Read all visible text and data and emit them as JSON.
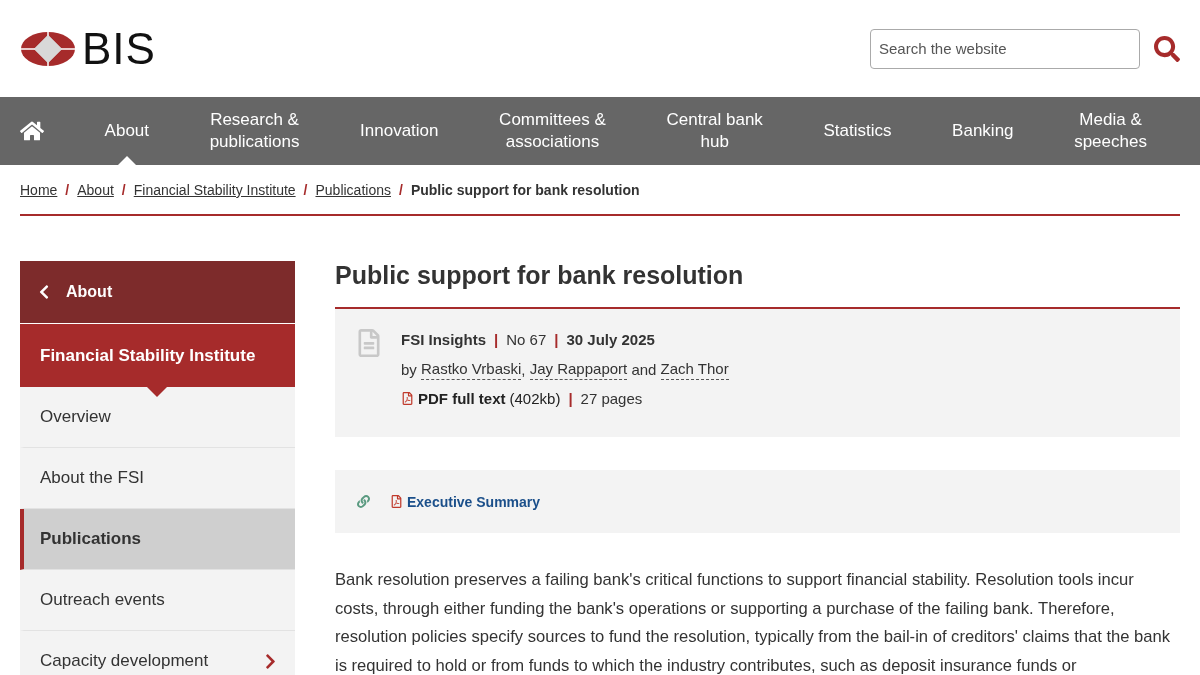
{
  "header": {
    "logo_text": "BIS",
    "search": {
      "placeholder": "Search the website"
    }
  },
  "nav": [
    {
      "label": "About",
      "selected": true
    },
    {
      "label": "Research &\npublications",
      "selected": false
    },
    {
      "label": "Innovation",
      "selected": false
    },
    {
      "label": "Committees &\nassociations",
      "selected": false
    },
    {
      "label": "Central bank\nhub",
      "selected": false
    },
    {
      "label": "Statistics",
      "selected": false
    },
    {
      "label": "Banking",
      "selected": false
    },
    {
      "label": "Media &\nspeeches",
      "selected": false
    }
  ],
  "breadcrumb": {
    "separator": "/",
    "links": [
      "Home",
      "About",
      "Financial Stability Institute",
      "Publications"
    ],
    "current": "Public support for bank resolution"
  },
  "sidebar": {
    "back": "About",
    "section": "Financial Stability Institute",
    "items": [
      {
        "label": "Overview",
        "selected": false,
        "expandable": false
      },
      {
        "label": "About the FSI",
        "selected": false,
        "expandable": false
      },
      {
        "label": "Publications",
        "selected": true,
        "expandable": false
      },
      {
        "label": "Outreach events",
        "selected": false,
        "expandable": false
      },
      {
        "label": "Capacity development",
        "selected": false,
        "expandable": true
      }
    ]
  },
  "article": {
    "title": "Public support for bank resolution",
    "series": "FSI Insights",
    "number": "No 67",
    "date": "30 July 2025",
    "divider": "|",
    "comma": ",",
    "by": "by",
    "authors": [
      "Rastko Vrbaski",
      "Jay Rappaport",
      "Zach Thor"
    ],
    "and": "and",
    "pdf_label": "PDF full text",
    "pdf_size": "(402kb)",
    "pages": "27 pages",
    "attachment": "Executive Summary",
    "body": "Bank resolution preserves a failing bank's critical functions to support financial stability. Resolution tools incur costs, through either funding the bank's operations or supporting a purchase of the failing bank. Therefore, resolution policies specify sources to fund the resolution, typically from the bail-in of creditors' claims that the bank is required to hold or from funds to which the industry contributes, such as deposit insurance funds or"
  }
}
